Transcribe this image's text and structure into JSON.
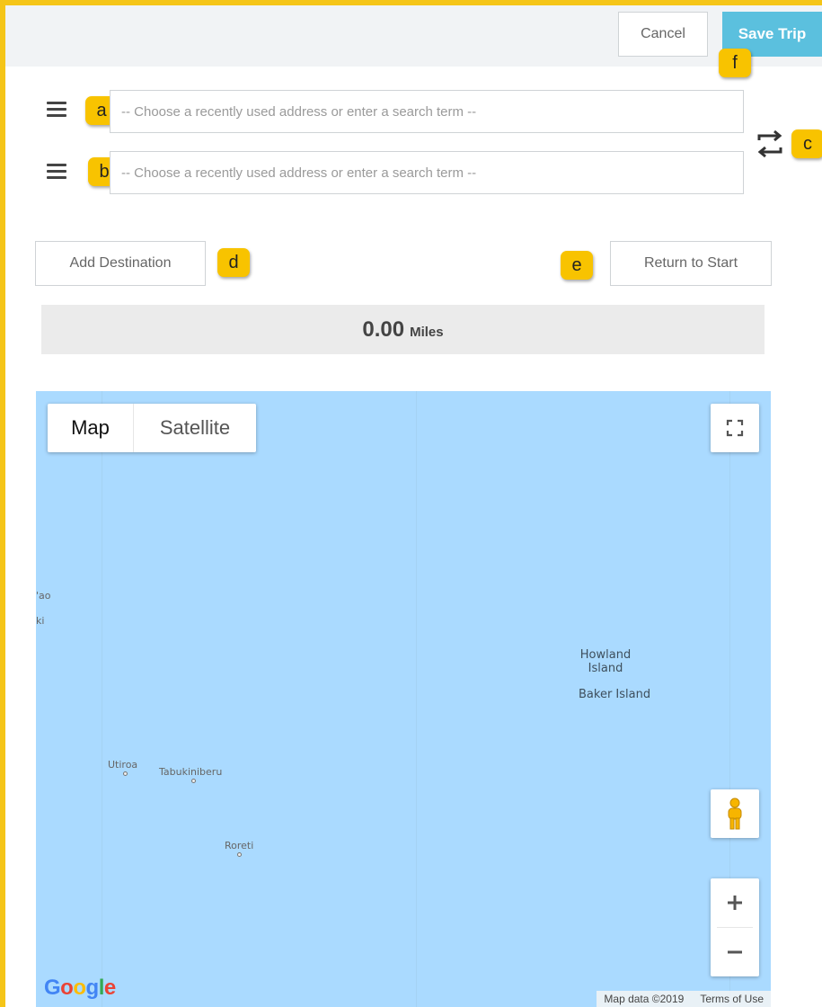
{
  "toolbar": {
    "cancel_label": "Cancel",
    "save_label": "Save Trip"
  },
  "badges": {
    "a": "a",
    "b": "b",
    "c": "c",
    "d": "d",
    "e": "e",
    "f": "f"
  },
  "stops": [
    {
      "placeholder": "-- Choose a recently used address or enter a search term --",
      "value": ""
    },
    {
      "placeholder": "-- Choose a recently used address or enter a search term --",
      "value": ""
    }
  ],
  "actions": {
    "add_destination": "Add Destination",
    "return_to_start": "Return to Start"
  },
  "distance": {
    "value": "0.00",
    "unit": "Miles"
  },
  "map": {
    "tabs": {
      "map": "Map",
      "satellite": "Satellite"
    },
    "places": {
      "edge1": "'ao",
      "edge2": "ki",
      "howland": "Howland\nIsland",
      "baker": "Baker Island",
      "utiroa": "Utiroa",
      "tabukiniberu": "Tabukiniberu",
      "roreti": "Roreti"
    },
    "attribution": {
      "data": "Map data ©2019",
      "terms": "Terms of Use"
    }
  },
  "colors": {
    "accent": "#f5c518",
    "save": "#5bc0de",
    "water": "#aadaff"
  }
}
